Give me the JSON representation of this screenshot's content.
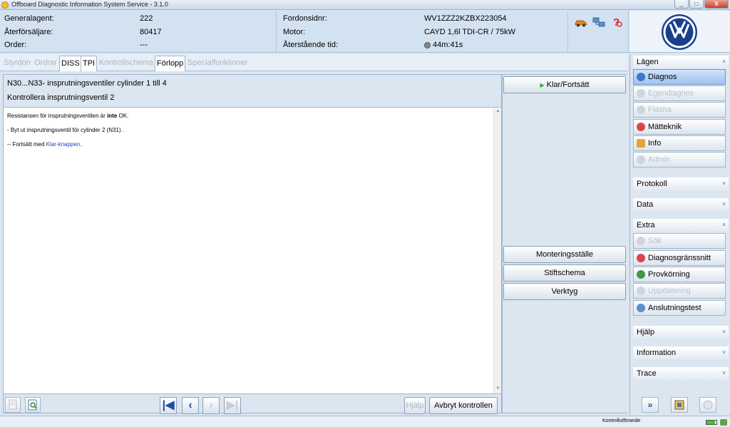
{
  "window": {
    "title": "Offboard Diagnostic Information System Service - 3.1.0",
    "buttons": [
      "_",
      "□",
      "X"
    ]
  },
  "header": {
    "left": [
      {
        "label": "Generalagent:",
        "value": "222"
      },
      {
        "label": "Återförsäljare:",
        "value": "80417"
      },
      {
        "label": "Order:",
        "value": "---"
      }
    ],
    "mid": [
      {
        "label": "Fordonsidnr:",
        "value": "WV1ZZZ2KZBX223054"
      },
      {
        "label": "Motor:",
        "value": "CAYD 1,6l TDI-CR / 75kW"
      },
      {
        "label": "Återstående tid:",
        "value": "44m:41s"
      }
    ]
  },
  "tabs": [
    {
      "label": "Styrdon",
      "active": false
    },
    {
      "label": "Ordrar",
      "active": false
    },
    {
      "label": "DISS",
      "active": true
    },
    {
      "label": "TPI",
      "active": true
    },
    {
      "label": "Kontrollschema",
      "active": false
    },
    {
      "label": "Förlopp",
      "active": true
    },
    {
      "label": "Specialfunktioner",
      "active": false
    }
  ],
  "content": {
    "heading1": "N30...N33- insprutningsventiler cylinder 1 till 4",
    "heading2": "Kontrollera insprutningsventil 2",
    "line1_a": "Resistansen för insprutningsventilen är ",
    "line1_b": "inte",
    "line1_c": " OK.",
    "line2": "- Byt ut insprutningsventil för cylinder 2 (N31)  .",
    "line3_a": "-- Fortsätt med ",
    "line3_b": "Klar-knappen",
    "line3_c": "."
  },
  "footer": {
    "nav": {
      "first": "|◀",
      "prev": "‹",
      "next": "›",
      "last": "▶|"
    },
    "help_label": "Hjälp",
    "abort_label": "Avbryt kontrollen"
  },
  "actions": {
    "done_label": "Klar/Fortsätt",
    "done_glyph": "▶",
    "mount_label": "Monteringsställe",
    "pin_label": "Stiftschema",
    "tools_label": "Verktyg"
  },
  "sidebar": {
    "modes_title": "Lägen",
    "modes": [
      {
        "label": "Diagnos",
        "state": "active"
      },
      {
        "label": "Egendiagnos",
        "state": "disabled"
      },
      {
        "label": "Flasha",
        "state": "disabled"
      },
      {
        "label": "Mätteknik",
        "state": "normal"
      },
      {
        "label": "Info",
        "state": "normal"
      },
      {
        "label": "Admin",
        "state": "disabled"
      }
    ],
    "protocol_title": "Protokoll",
    "data_title": "Data",
    "extra_title": "Extra",
    "extras": [
      {
        "label": "Sök",
        "state": "disabled"
      },
      {
        "label": "Diagnosgränssnitt",
        "state": "normal"
      },
      {
        "label": "Provkörning",
        "state": "normal"
      },
      {
        "label": "Uppdatering",
        "state": "disabled"
      },
      {
        "label": "Anslutningstest",
        "state": "normal"
      }
    ],
    "help_title": "Hjälp",
    "info_title": "Information",
    "trace_title": "Trace",
    "chev_up": "˄",
    "chev_down": "˅",
    "bottom_forward": "»"
  },
  "status": {
    "text": "Kontrollutförande"
  },
  "colors": {
    "accent": "#1b4fa8",
    "link": "#2a3fb8",
    "green_play": "#2fa52f"
  }
}
